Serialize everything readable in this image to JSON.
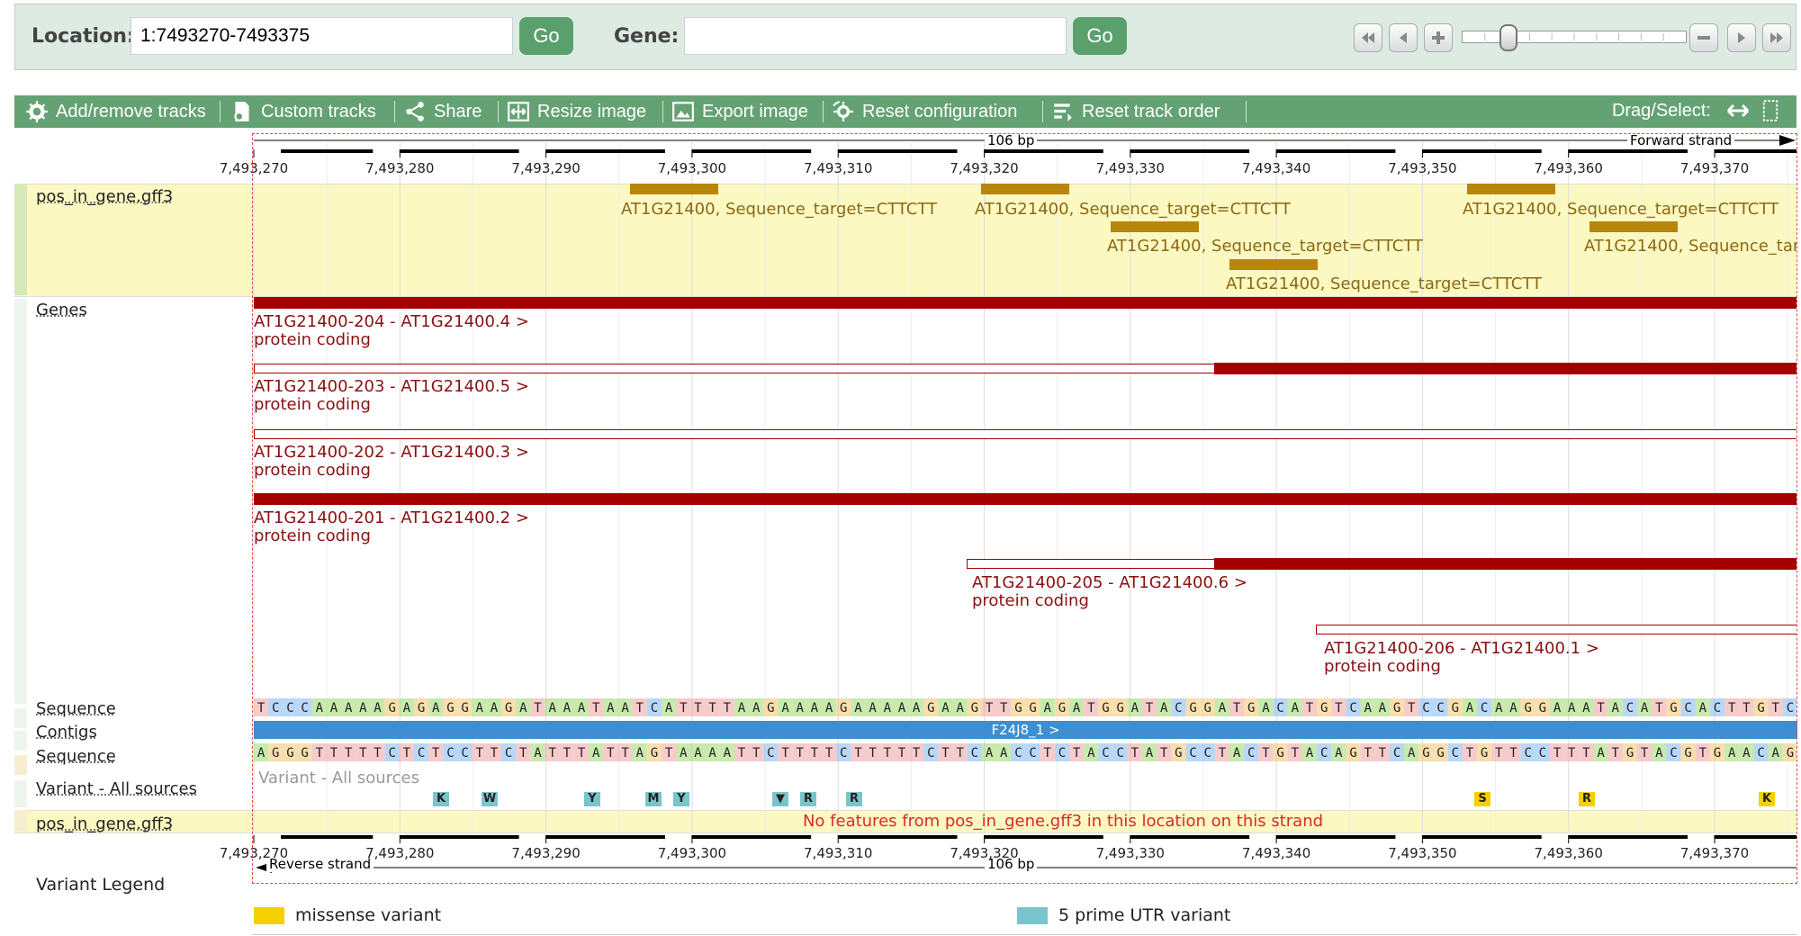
{
  "location_bar": {
    "location_label": "Location:",
    "location_value": "1:7493270-7493375",
    "go_label": "Go",
    "gene_label": "Gene:",
    "gene_value": "",
    "go2_label": "Go"
  },
  "toolbar": {
    "items": [
      {
        "label": "Add/remove tracks",
        "icon": "gear-icon"
      },
      {
        "label": "Custom tracks",
        "icon": "custom-tracks-icon"
      },
      {
        "label": "Share",
        "icon": "share-icon"
      },
      {
        "label": "Resize image",
        "icon": "resize-icon"
      },
      {
        "label": "Export image",
        "icon": "export-image-icon"
      },
      {
        "label": "Reset configuration",
        "icon": "reset-config-icon"
      },
      {
        "label": "Reset track order",
        "icon": "reset-order-icon"
      }
    ],
    "drag_select_label": "Drag/Select:"
  },
  "ruler": {
    "top_span_label": "106 bp",
    "forward_strand": "Forward strand",
    "reverse_strand": "Reverse strand",
    "bottom_span_label": "106 bp",
    "ticks": [
      "7,493,270",
      "7,493,280",
      "7,493,290",
      "7,493,300",
      "7,493,310",
      "7,493,320",
      "7,493,330",
      "7,493,340",
      "7,493,350",
      "7,493,360",
      "7,493,370"
    ]
  },
  "tracks": {
    "pos_in_gene_top": {
      "label": "pos_in_gene.gff3",
      "features": [
        {
          "text": "AT1G21400, Sequence_target=CTTCTT"
        },
        {
          "text": "AT1G21400, Sequence_target=CTTCTT"
        },
        {
          "text": "AT1G21400, Sequence_target=CTTCTT"
        },
        {
          "text": "AT1G21400, Sequence_target=CTTCTT"
        },
        {
          "text": "AT1G21400, Sequence_target=CTTCTT"
        },
        {
          "text": "AT1G21400, Sequence_targ"
        }
      ]
    },
    "genes": {
      "label": "Genes",
      "transcripts": [
        {
          "name": "AT1G21400-204 - AT1G21400.4 >",
          "biotype": "protein coding"
        },
        {
          "name": "AT1G21400-203 - AT1G21400.5 >",
          "biotype": "protein coding"
        },
        {
          "name": "AT1G21400-202 - AT1G21400.3 >",
          "biotype": "protein coding"
        },
        {
          "name": "AT1G21400-201 - AT1G21400.2 >",
          "biotype": "protein coding"
        },
        {
          "name": "AT1G21400-205 - AT1G21400.6 >",
          "biotype": "protein coding"
        },
        {
          "name": "AT1G21400-206 - AT1G21400.1 >",
          "biotype": "protein coding"
        }
      ]
    },
    "sequence_forward": {
      "label": "Sequence",
      "bases": "TCCCAAAAAGAGAGGAAGATAAATAATCATTTTAAGAAAAGAAAAAGAAGTTGGAGATGGATACGGATGACATGTCAAGTCCGACAAGGAAATACATGCACTTGTC"
    },
    "contigs": {
      "label": "Contigs",
      "contig_name": "F24J8_1 >"
    },
    "sequence_reverse": {
      "label": "Sequence",
      "bases": "AGGGTTTTTCTCTCCTTCTATTTATTAGTAAAATTCTTTTCTTTTTCTTCAACCTCTACCTATGCCTACTGTACAGTTCAGGCTGTTCCTTTATGTACGTGAACAG"
    },
    "variants": {
      "label": "Variant - All sources",
      "inner_label": "Variant - All sources",
      "badges": [
        {
          "code": "K",
          "type": "utr"
        },
        {
          "code": "W",
          "type": "utr"
        },
        {
          "code": "Y",
          "type": "utr"
        },
        {
          "code": "M",
          "type": "utr"
        },
        {
          "code": "Y",
          "type": "utr"
        },
        {
          "code": "▼",
          "type": "utr"
        },
        {
          "code": "R",
          "type": "utr"
        },
        {
          "code": "R",
          "type": "utr"
        },
        {
          "code": "S",
          "type": "missense"
        },
        {
          "code": "R",
          "type": "missense"
        },
        {
          "code": "K",
          "type": "missense"
        }
      ]
    },
    "pos_in_gene_bottom": {
      "label": "pos_in_gene.gff3",
      "message": "No features from pos_in_gene.gff3 in this location on this strand"
    }
  },
  "legend": {
    "title": "Variant Legend",
    "items": [
      {
        "label": "missense variant",
        "color": "#f5d000"
      },
      {
        "label": "5 prime UTR variant",
        "color": "#7ac5cd"
      }
    ]
  },
  "colors": {
    "toolbar": "#64a274",
    "gene_red": "#a50000",
    "feature_gold": "#b8860b",
    "track_yellow": "#fcf8c2",
    "contig_blue": "#3e8ed0"
  }
}
